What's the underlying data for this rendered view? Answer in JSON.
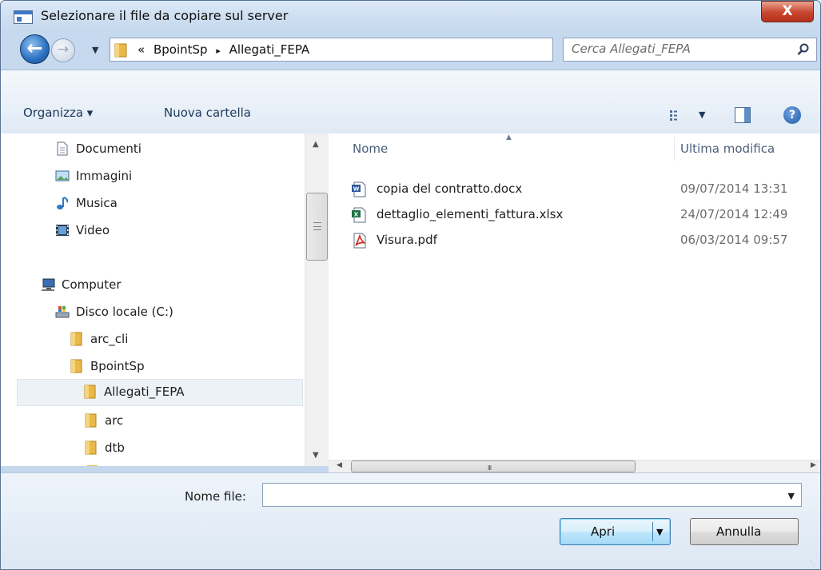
{
  "window": {
    "title": "Selezionare il file da copiare sul server",
    "close_label": "X"
  },
  "address": {
    "overflow": "«",
    "crumbs": [
      "BpointSp",
      "▸",
      "Allegati_FEPA"
    ],
    "search_placeholder": "Cerca Allegati_FEPA"
  },
  "toolbar": {
    "organize_label": "Organizza ▾",
    "new_folder_label": "Nuova cartella"
  },
  "nav": {
    "items": [
      {
        "label": "Documenti",
        "icon": "document-icon"
      },
      {
        "label": "Immagini",
        "icon": "pictures-icon"
      },
      {
        "label": "Musica",
        "icon": "music-icon"
      },
      {
        "label": "Video",
        "icon": "video-icon"
      },
      {
        "label": "Computer",
        "icon": "computer-icon"
      },
      {
        "label": "Disco locale (C:)",
        "icon": "drive-icon"
      },
      {
        "label": "arc_cli",
        "icon": "folder-icon"
      },
      {
        "label": "BpointSp",
        "icon": "folder-icon"
      },
      {
        "label": "Allegati_FEPA",
        "icon": "folder-icon",
        "selected": true
      },
      {
        "label": "arc",
        "icon": "folder-icon"
      },
      {
        "label": "dtb",
        "icon": "folder-icon"
      }
    ]
  },
  "files": {
    "columns": [
      "Nome",
      "Ultima modifica"
    ],
    "rows": [
      {
        "name": "copia del contratto.docx",
        "date": "09/07/2014 13:31",
        "icon": "word-icon"
      },
      {
        "name": "dettaglio_elementi_fattura.xlsx",
        "date": "24/07/2014 12:49",
        "icon": "excel-icon"
      },
      {
        "name": "Visura.pdf",
        "date": "06/03/2014 09:57",
        "icon": "pdf-icon"
      }
    ]
  },
  "scroll": {
    "h_grip": "III"
  },
  "bottom": {
    "filename_label": "Nome file:",
    "filename_value": "",
    "open_label": "Apri",
    "cancel_label": "Annulla"
  },
  "colors": {
    "chrome": "#c4d7ec",
    "close": "#c8452e",
    "accent": "#3c7fb1"
  }
}
